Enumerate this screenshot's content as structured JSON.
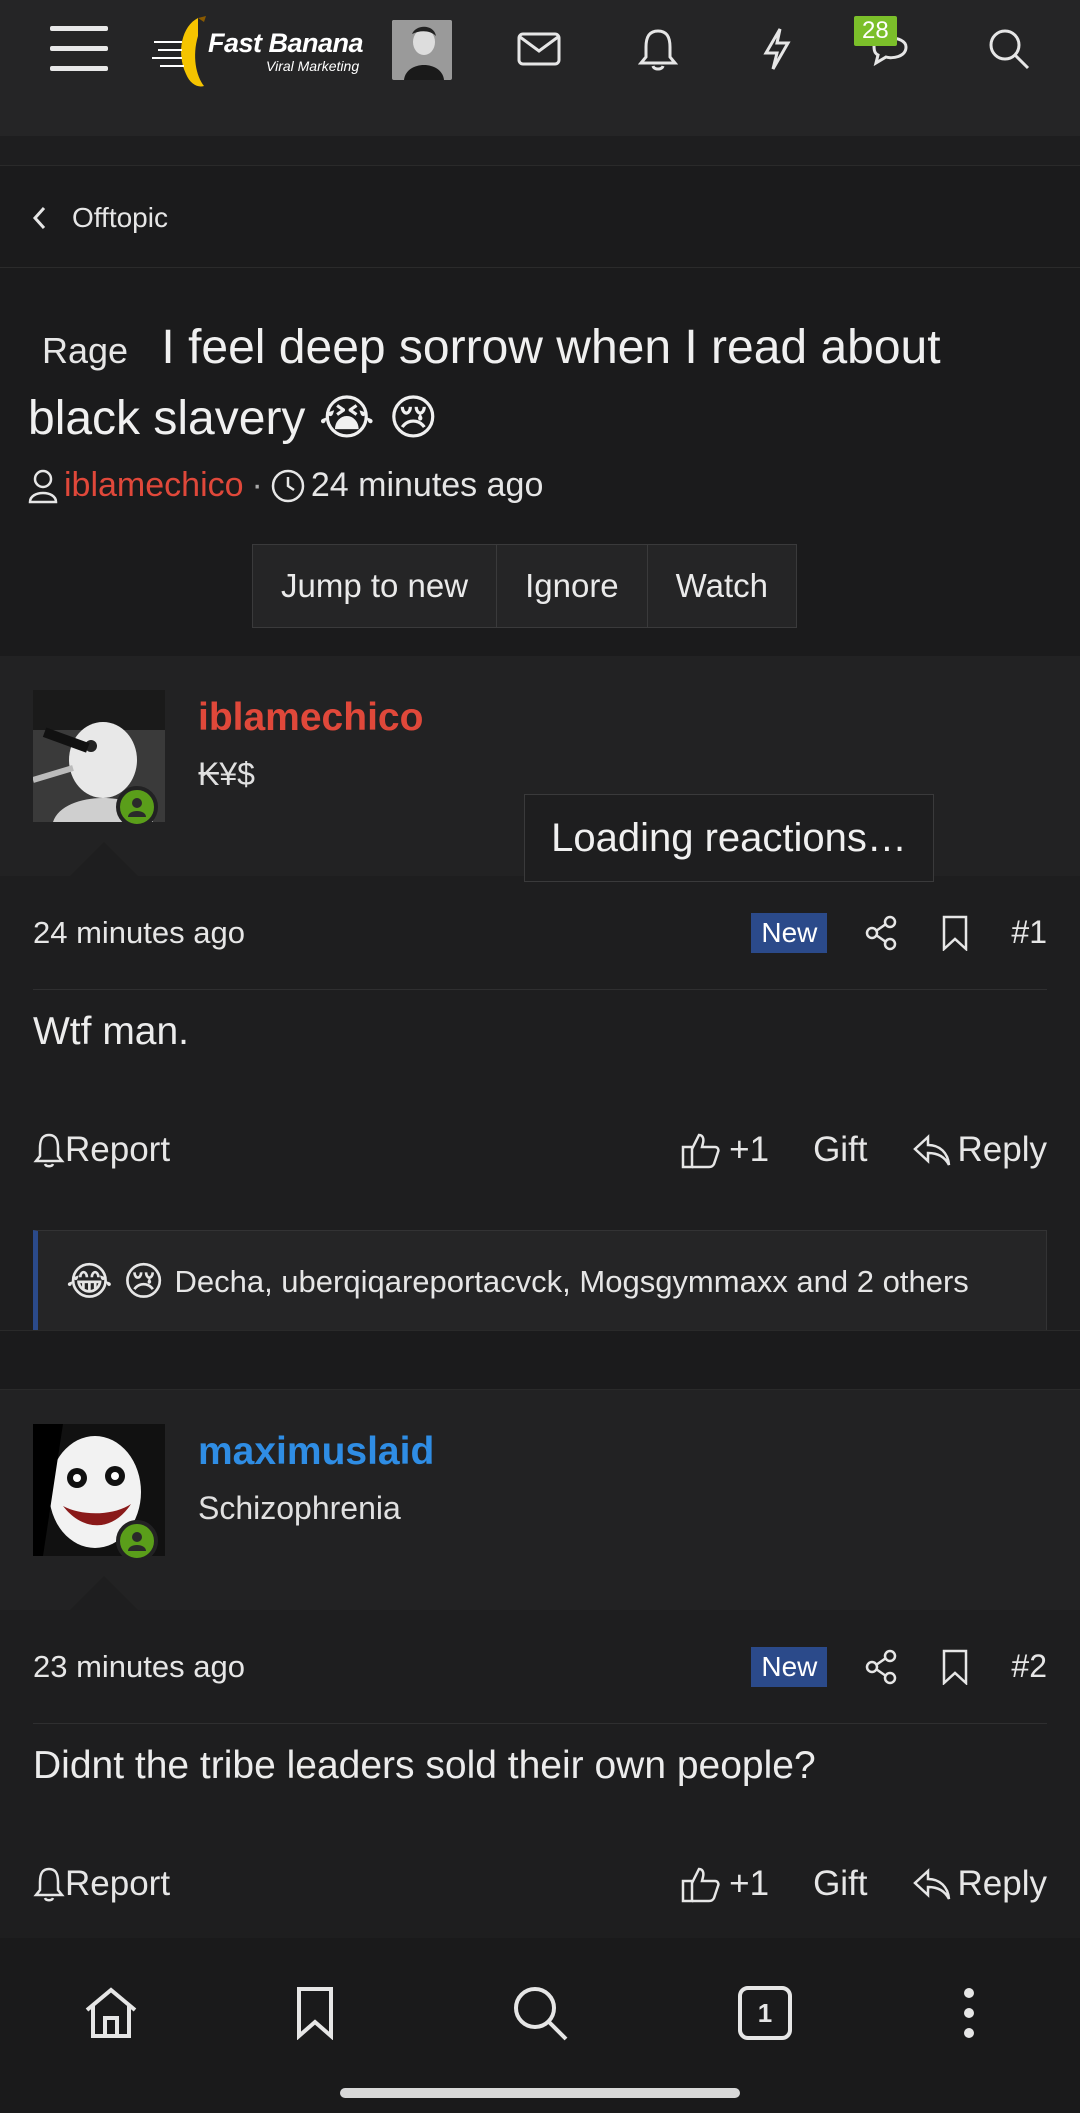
{
  "topbar": {
    "logo_brand": "Fast Banana",
    "logo_tagline": "Viral Marketing",
    "notification_count": "28"
  },
  "breadcrumb": {
    "label": "Offtopic"
  },
  "thread": {
    "prefix": "Rage",
    "title": "I feel deep sorrow when I read about black slavery 😭 😢",
    "author": "iblamechico",
    "separator": "·",
    "time": "24 minutes ago",
    "buttons": {
      "jump": "Jump to new",
      "ignore": "Ignore",
      "watch": "Watch"
    }
  },
  "posts": [
    {
      "username": "iblamechico",
      "username_color": "#e0483a",
      "user_title": "₭¥$",
      "time": "24 minutes ago",
      "new_label": "New",
      "number": "#1",
      "message": "Wtf man.",
      "loading_text": "Loading reactions…",
      "report": "Report",
      "like": "+1",
      "gift": "Gift",
      "reply": "Reply",
      "reactions_emoji": [
        "😂",
        "😢"
      ],
      "reactions_text": "Decha, uberqiqareportacvck, Mogsgymmaxx and 2 others"
    },
    {
      "username": "maximuslaid",
      "username_color": "#2f8de4",
      "user_title": "Schizophrenia",
      "time": "23 minutes ago",
      "new_label": "New",
      "number": "#2",
      "message": "Didnt the tribe leaders sold their own people?",
      "report": "Report",
      "like": "+1",
      "gift": "Gift",
      "reply": "Reply"
    }
  ],
  "bottomnav": {
    "tab_count": "1"
  },
  "colors": {
    "accent_new": "#2b4a8a",
    "online": "#5a9e1a",
    "badge": "#7bbf2a"
  }
}
